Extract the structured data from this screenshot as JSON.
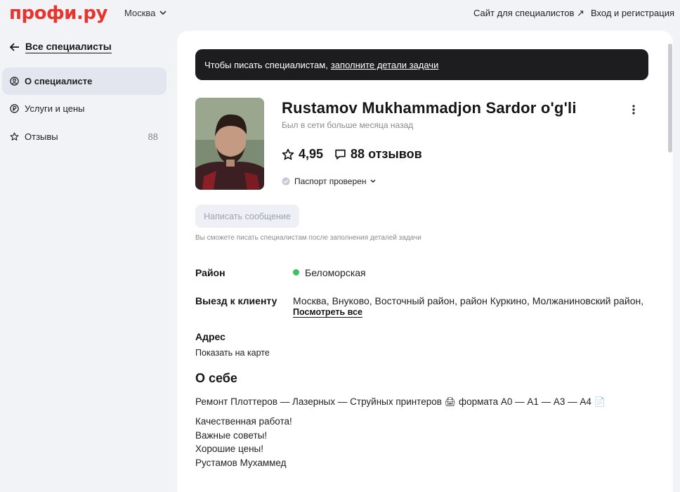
{
  "header": {
    "logo_text": "профи.ру",
    "city": "Москва",
    "spec_site_link": "Сайт для специалистов ↗",
    "login_link": "Вход и регистрация"
  },
  "sidebar": {
    "back_label": "Все специалисты",
    "items": [
      {
        "label": "О специалисте",
        "icon": "user-circle-icon",
        "active": true
      },
      {
        "label": "Услуги и цены",
        "icon": "ruble-icon",
        "active": false
      },
      {
        "label": "Отзывы",
        "icon": "star-icon",
        "count": "88",
        "active": false
      }
    ]
  },
  "banner": {
    "text": "Чтобы писать специалистам,",
    "link": "заполните детали задачи"
  },
  "profile": {
    "name": "Rustamov Mukhammadjon Sardor o'g'li",
    "last_seen": "Был в сети больше месяца назад",
    "rating": "4,95",
    "reviews": "88 отзывов",
    "passport": "Паспорт проверен",
    "message_button": "Написать сообщение",
    "message_hint": "Вы сможете писать специалистам после заполнения деталей задачи"
  },
  "details": {
    "district_label": "Район",
    "district_value": "Беломорская",
    "visit_label": "Выезд к клиенту",
    "visit_value": "Москва, Внуково, Восточный район, район Куркино, Молжаниновский район,",
    "see_all": "Посмотреть все",
    "address_label": "Адрес",
    "show_on_map": "Показать на карте"
  },
  "about": {
    "title": "О себе",
    "line1": "Ремонт Плоттеров — Лазерных — Струйных принтеров",
    "line1_tail": "формата А0 — А1 — А3 — А4",
    "line2": "Качественная работа!",
    "line3": "Важные советы!",
    "line4": "Хорошие цены!",
    "line5": "Рустамов Мухаммед"
  },
  "colors": {
    "brand": "#e8342c",
    "status_online": "#3cc15e",
    "banner_bg": "#1d1d1f"
  }
}
